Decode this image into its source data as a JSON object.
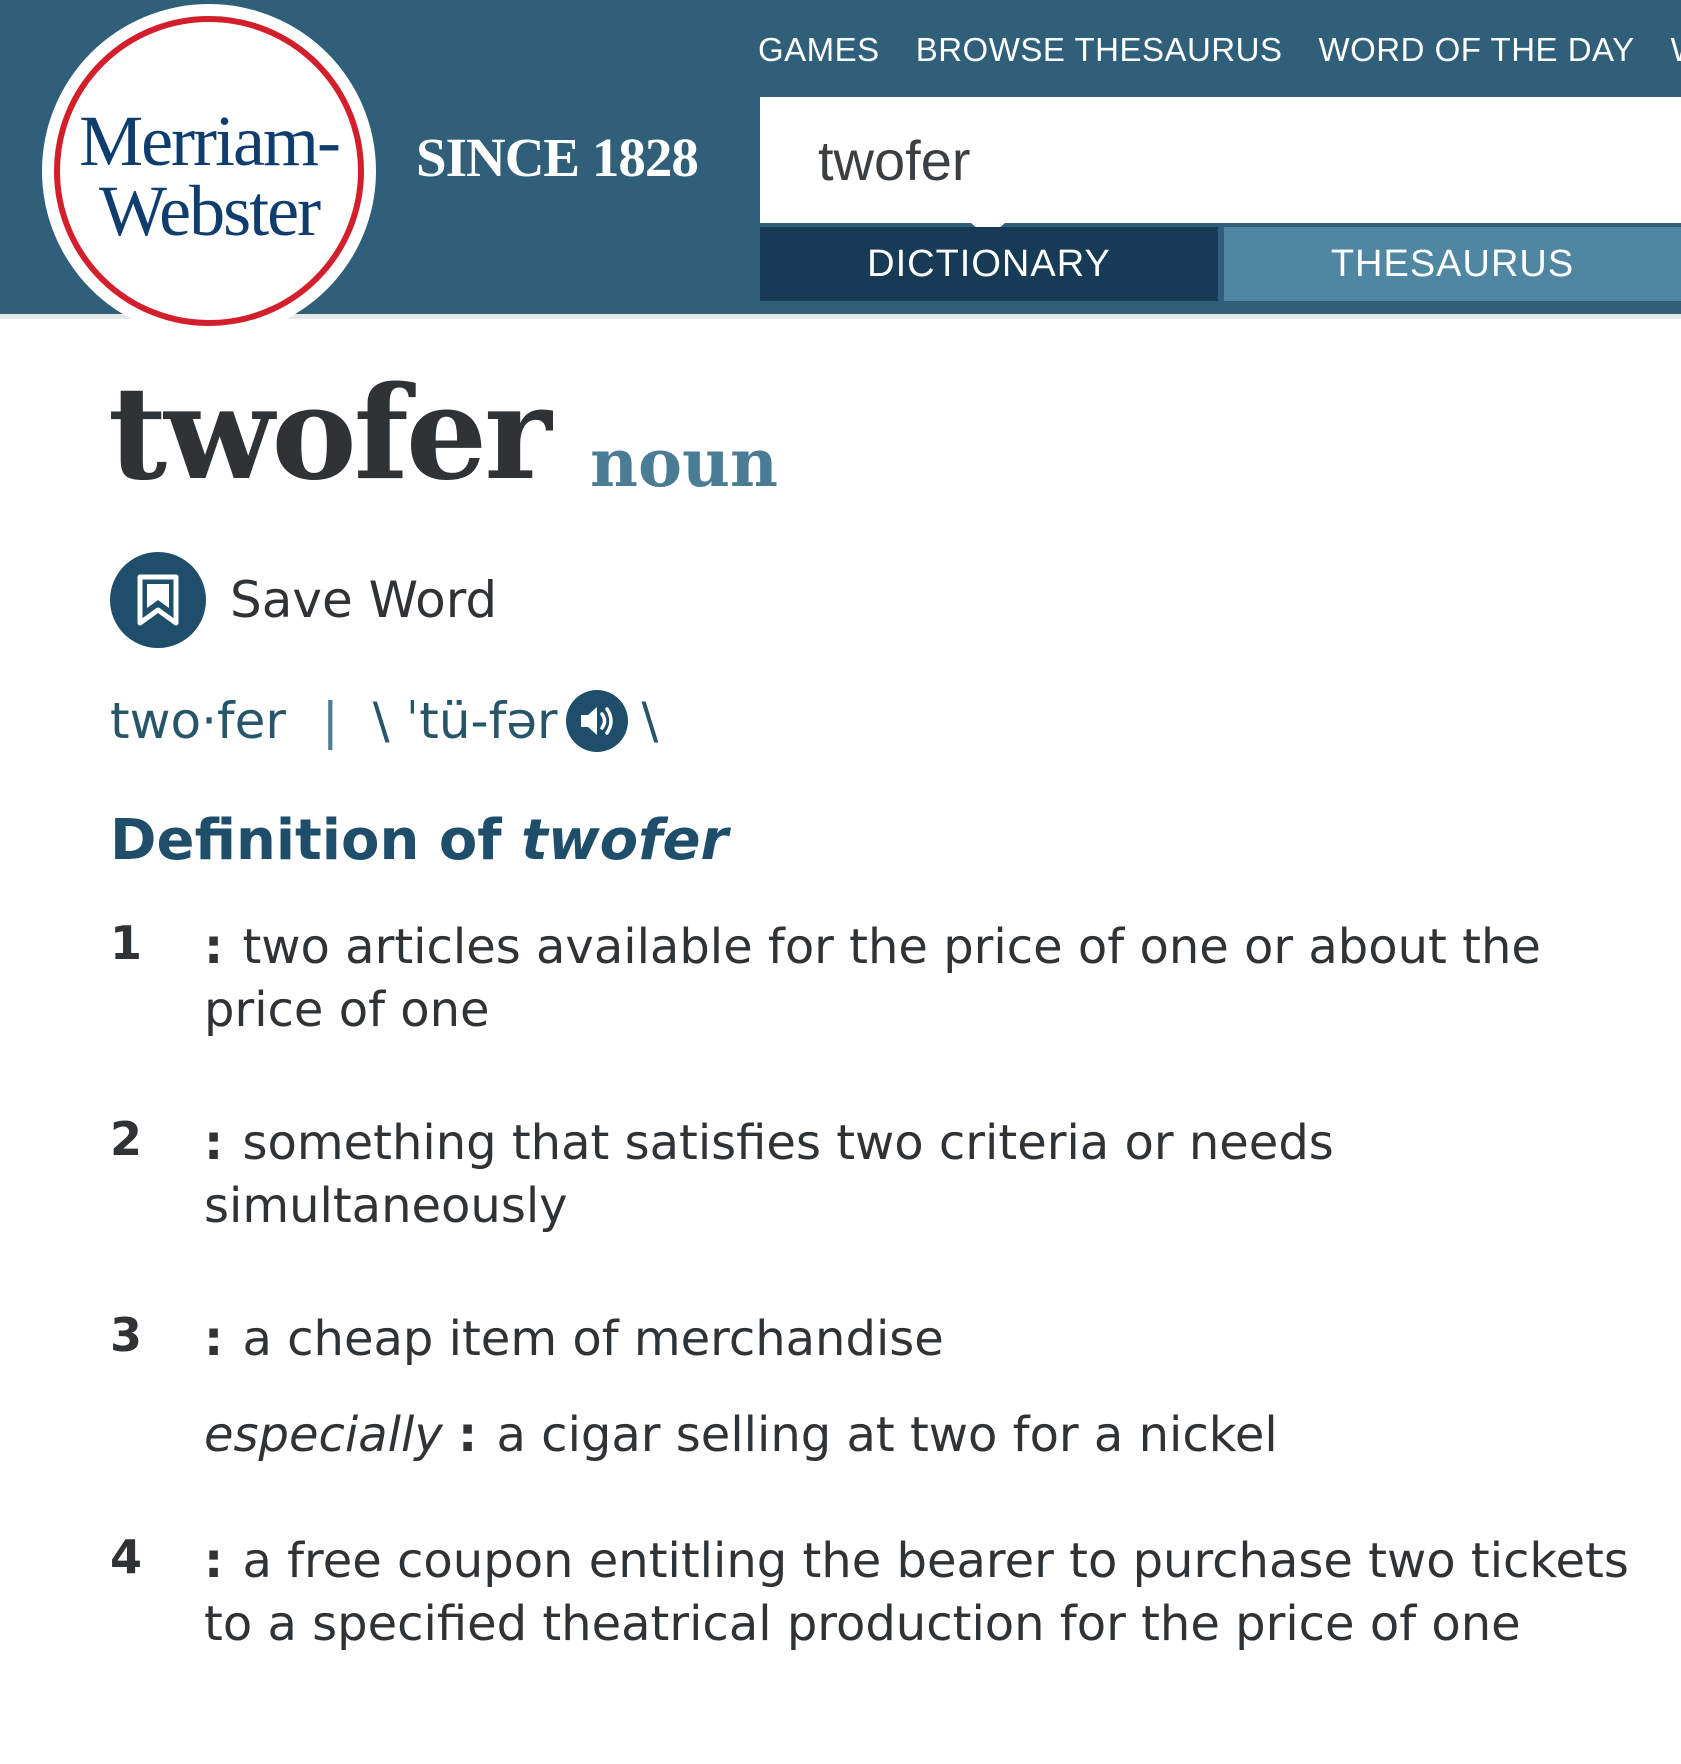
{
  "header": {
    "logo": {
      "line1": "Merriam-",
      "line2": "Webster"
    },
    "since": "SINCE 1828",
    "nav": [
      "GAMES",
      "BROWSE THESAURUS",
      "WORD OF THE DAY",
      "W"
    ],
    "search": {
      "value": "twofer"
    },
    "tabs": {
      "dictionary": "DICTIONARY",
      "thesaurus": "THESAURUS"
    }
  },
  "entry": {
    "headword": "twofer",
    "pos": "noun",
    "save_label": "Save Word",
    "syllables": "two·fer",
    "separator": "|",
    "pron_open": "\\ ˈtü-fər",
    "pron_close": "\\",
    "definition_heading": "Definition of",
    "definition_word": "twofer",
    "senses": [
      {
        "num": "1",
        "colon": ":",
        "text": "two articles available for the price of one or about the price of one"
      },
      {
        "num": "2",
        "colon": ":",
        "text": "something that satisfies two criteria or needs simultaneously"
      },
      {
        "num": "3",
        "colon": ":",
        "text": "a cheap item of merchandise",
        "sd": "especially",
        "sd_colon": ":",
        "sd_text": "a cigar selling at two for a nickel"
      },
      {
        "num": "4",
        "colon": ":",
        "text": "a free coupon entitling the bearer to purchase two tickets to a specified theatrical production for the price of one"
      }
    ]
  },
  "colors": {
    "header_bg": "#305f7a",
    "logo_ring": "#d21f2b",
    "logo_text": "#0f3d6e",
    "tab_active": "#173b55",
    "tab_inactive": "#4f86a2",
    "accent": "#1e4e6a"
  },
  "icons": {
    "save": "bookmark-icon",
    "audio": "speaker-icon"
  }
}
